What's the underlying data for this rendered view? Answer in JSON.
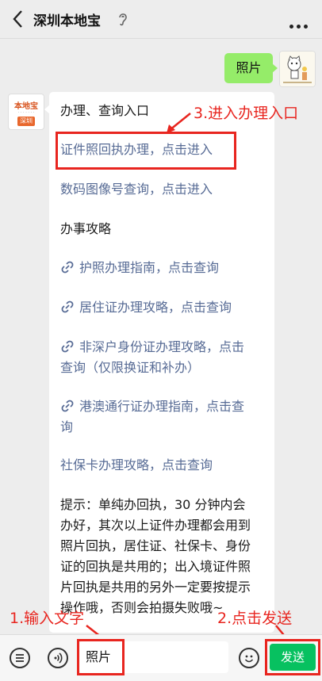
{
  "header": {
    "title": "深圳本地宝"
  },
  "chat": {
    "user_message": "照片",
    "bot": {
      "logo_text": "本地宝",
      "logo_tag": "深圳",
      "heading": "办理、查询入口",
      "entry_links": [
        "证件照回执办理，点击进入",
        "数码图像号查询，点击进入"
      ],
      "guide_heading": "办事攻略",
      "guides": [
        {
          "line1": "护照办理指南，点击查询"
        },
        {
          "line1": "居住证办理攻略，点击查询"
        },
        {
          "line1": "非深户身份证办理攻略，点击",
          "line2": "查询（仅限换证和补办）"
        },
        {
          "line1": "港澳通行证办理指南，点击查",
          "line2": "询"
        }
      ],
      "social_card_link": "社保卡办理攻略，点击查询",
      "tip_lines": [
        "提示：单纯办回执，30 分钟内会",
        "办好，其次以上证件办理都会用到",
        "照片回执，居住证、社保卡、身份",
        "证的回执是共用的；出入境证件照",
        "片回执是共用的另外一定要按提示",
        "操作哦，否则会拍摄失败哦~"
      ]
    }
  },
  "annotations": {
    "step1": "1.输入文字",
    "step2": "2.点击发送",
    "step3": "3.进入办理入口"
  },
  "bottom": {
    "input_value": "照片",
    "send_label": "发送"
  },
  "colors": {
    "accent_green": "#07c160",
    "bubble_green": "#95ec69",
    "link_blue": "#576b95",
    "annotation_red": "#e8251f"
  }
}
